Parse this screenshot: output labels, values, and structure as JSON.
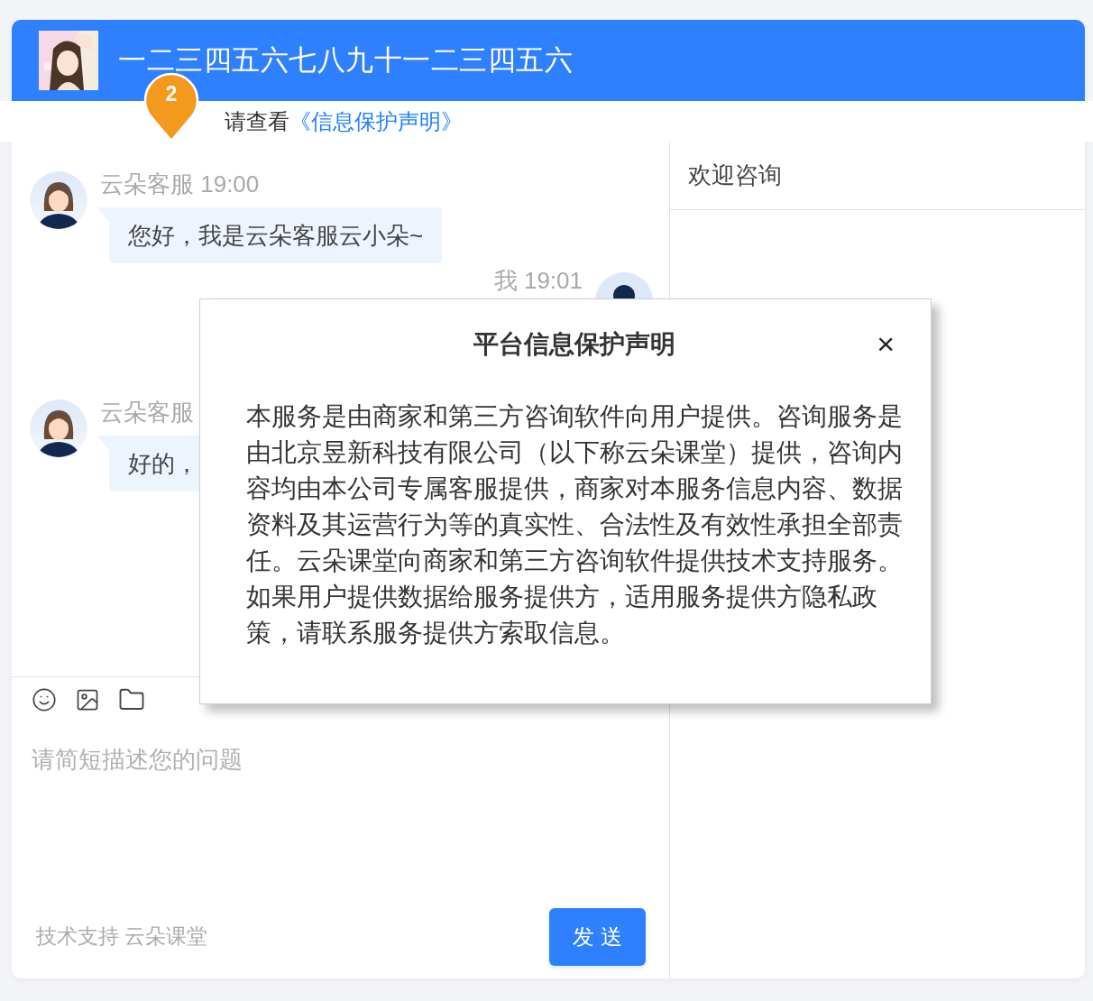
{
  "header": {
    "title": "一二三四五六七八九十一二三四五六"
  },
  "marker": {
    "label": "2"
  },
  "notice": {
    "text": "请查看",
    "link": "《信息保护声明》"
  },
  "messages": [
    {
      "kind": "agent",
      "meta": "云朵客服 19:00",
      "text": "您好，我是云朵客服云小朵~"
    },
    {
      "kind": "me",
      "meta": "我 19:01"
    },
    {
      "kind": "agent",
      "meta": "云朵客服",
      "text": "好的，"
    }
  ],
  "composer": {
    "placeholder": "请简短描述您的问题"
  },
  "footer": {
    "credit": "技术支持 云朵课堂",
    "send": "发 送"
  },
  "side_panel": {
    "title": "欢迎咨询"
  },
  "modal": {
    "title": "平台信息保护声明",
    "close": "×",
    "body": "本服务是由商家和第三方咨询软件向用户提供。咨询服务是由北京昱新科技有限公司（以下称云朵课堂）提供，咨询内容均由本公司专属客服提供，商家对本服务信息内容、数据资料及其运营行为等的真实性、合法性及有效性承担全部责任。云朵课堂向商家和第三方咨询软件提供技术支持服务。如果用户提供数据给服务提供方，适用服务提供方隐私政策，请联系服务提供方索取信息。"
  }
}
